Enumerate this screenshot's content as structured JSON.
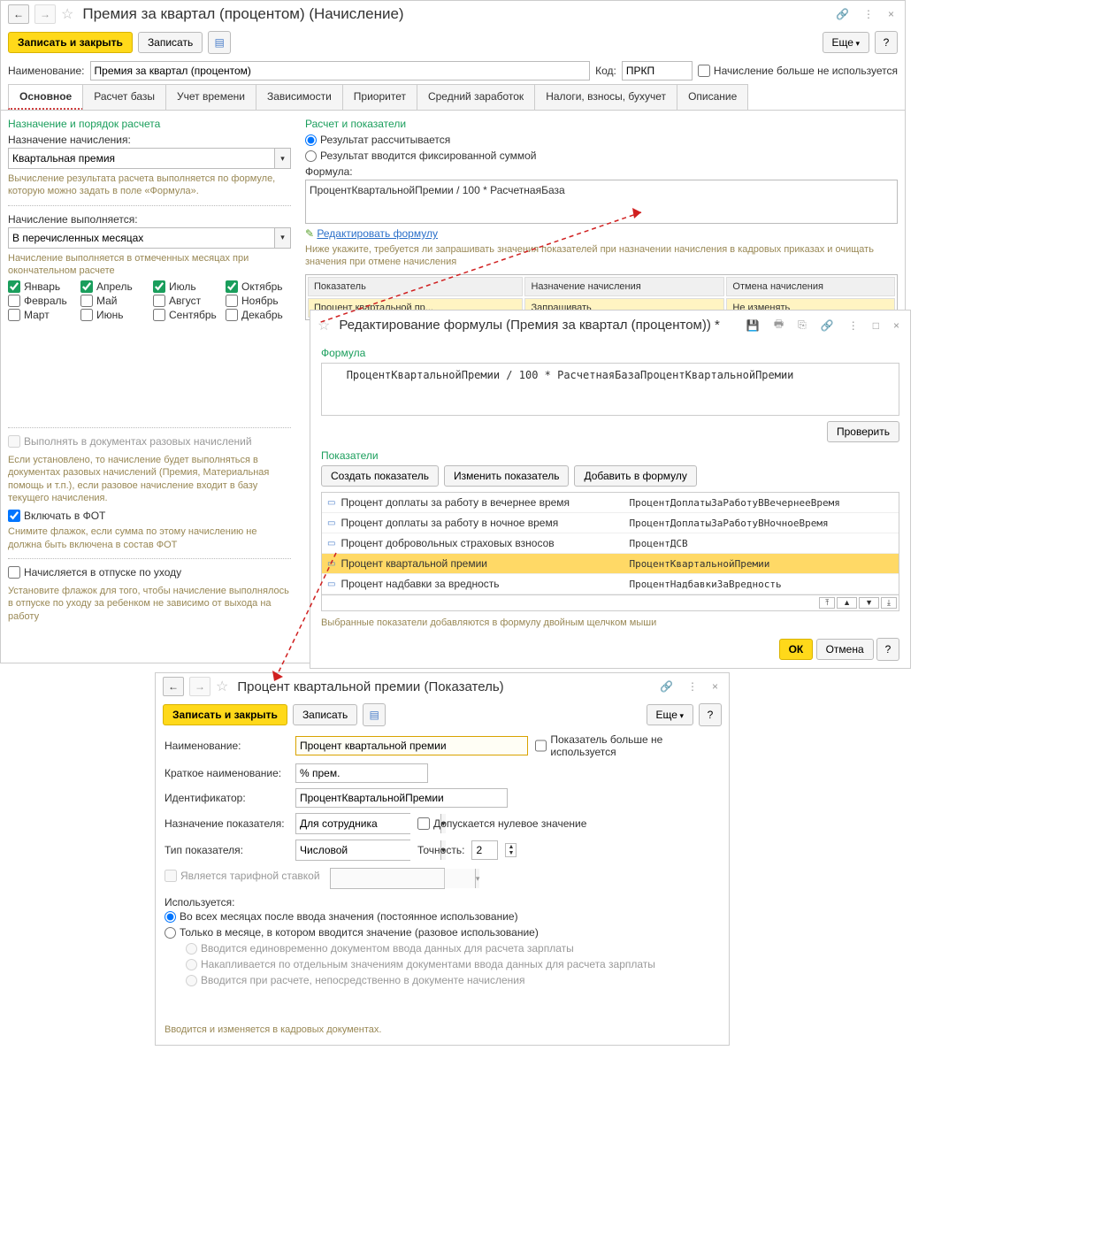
{
  "main": {
    "title": "Премия за квартал (процентом) (Начисление)",
    "save_close": "Записать и закрыть",
    "save": "Записать",
    "more": "Еще",
    "name_label": "Наименование:",
    "name_value": "Премия за квартал (процентом)",
    "code_label": "Код:",
    "code_value": "ПРКП",
    "not_used_label": "Начисление больше не используется",
    "tabs": [
      "Основное",
      "Расчет базы",
      "Учет времени",
      "Зависимости",
      "Приоритет",
      "Средний заработок",
      "Налоги, взносы, бухучет",
      "Описание"
    ],
    "left": {
      "section": "Назначение и порядок расчета",
      "assign_label": "Назначение начисления:",
      "assign_value": "Квартальная премия",
      "assign_hint": "Вычисление результата расчета выполняется по формуле, которую можно задать в поле «Формула».",
      "perform_label": "Начисление выполняется:",
      "perform_value": "В перечисленных месяцах",
      "perform_hint": "Начисление выполняется в отмеченных месяцах при окончательном расчете",
      "months": {
        "jan": "Январь",
        "feb": "Февраль",
        "mar": "Март",
        "apr": "Апрель",
        "may": "Май",
        "jun": "Июнь",
        "jul": "Июль",
        "aug": "Август",
        "sep": "Сентябрь",
        "oct": "Октябрь",
        "nov": "Ноябрь",
        "dec": "Декабрь"
      },
      "onetime_label": "Выполнять в документах разовых начислений",
      "onetime_hint": "Если установлено, то начисление будет выполняться в документах разовых начислений (Премия, Материальная помощь и т.п.), если разовое начисление входит в базу текущего начисления.",
      "fot_label": "Включать в ФОТ",
      "fot_hint": "Снимите флажок, если сумма по этому начислению не должна быть включена в состав ФОТ",
      "vacation_label": "Начисляется в отпуске по уходу",
      "vacation_hint": "Установите флажок для того, чтобы начисление выполнялось в отпуске по уходу за ребенком не зависимо от выхода на работу"
    },
    "right": {
      "section": "Расчет и показатели",
      "radio1": "Результат рассчитывается",
      "radio2": "Результат вводится фиксированной суммой",
      "formula_label": "Формула:",
      "formula_value": "ПроцентКвартальнойПремии / 100 * РасчетнаяБаза",
      "edit_link": "Редактировать формулу",
      "hint": "Ниже укажите, требуется ли запрашивать значения показателей при назначении начисления в кадровых приказах и очищать значения при отмене начисления",
      "table": {
        "h1": "Показатель",
        "h2": "Назначение начисления",
        "h3": "Отмена начисления",
        "r1c1": "Процент квартальной пр...",
        "r1c2": "Запрашивать",
        "r1c3": "Не изменять"
      }
    }
  },
  "formula": {
    "title": "Редактирование формулы (Премия за квартал (процентом)) *",
    "formula_label": "Формула",
    "formula_text": "ПроцентКвартальнойПремии / 100 * РасчетнаяБазаПроцентКвартальнойПремии",
    "check": "Проверить",
    "ind_label": "Показатели",
    "create": "Создать показатель",
    "edit": "Изменить показатель",
    "add": "Добавить в формулу",
    "rows": [
      {
        "name": "Процент доплаты за работу в вечернее время",
        "code": "ПроцентДоплатыЗаРаботуВВечернееВремя"
      },
      {
        "name": "Процент доплаты за работу в ночное время",
        "code": "ПроцентДоплатыЗаРаботуВНочноеВремя"
      },
      {
        "name": "Процент добровольных страховых взносов",
        "code": "ПроцентДСВ"
      },
      {
        "name": "Процент квартальной премии",
        "code": "ПроцентКвартальнойПремии"
      },
      {
        "name": "Процент надбавки за вредность",
        "code": "ПроцентНадбавкиЗаВредность"
      }
    ],
    "hint": "Выбранные показатели добавляются в формулу двойным щелчком мыши",
    "ok": "ОК",
    "cancel": "Отмена"
  },
  "indicator": {
    "title": "Процент квартальной премии (Показатель)",
    "save_close": "Записать и закрыть",
    "save": "Записать",
    "more": "Еще",
    "name_label": "Наименование:",
    "name_value": "Процент квартальной премии",
    "not_used_label": "Показатель больше не используется",
    "short_label": "Краткое наименование:",
    "short_value": "% прем.",
    "id_label": "Идентификатор:",
    "id_value": "ПроцентКвартальнойПремии",
    "purpose_label": "Назначение показателя:",
    "purpose_value": "Для сотрудника",
    "allow_zero": "Допускается нулевое значение",
    "type_label": "Тип показателя:",
    "type_value": "Числовой",
    "precision_label": "Точность:",
    "precision_value": "2",
    "is_rate": "Является тарифной ставкой",
    "usage_label": "Используется:",
    "usage_r1": "Во всех месяцах после ввода значения (постоянное использование)",
    "usage_r2": "Только в месяце, в котором вводится значение (разовое использование)",
    "sub_r1": "Вводится единовременно документом ввода данных для расчета зарплаты",
    "sub_r2": "Накапливается по отдельным значениям документами ввода данных для расчета зарплаты",
    "sub_r3": "Вводится при расчете, непосредственно в документе начисления",
    "footer_hint": "Вводится и изменяется в кадровых документах."
  }
}
